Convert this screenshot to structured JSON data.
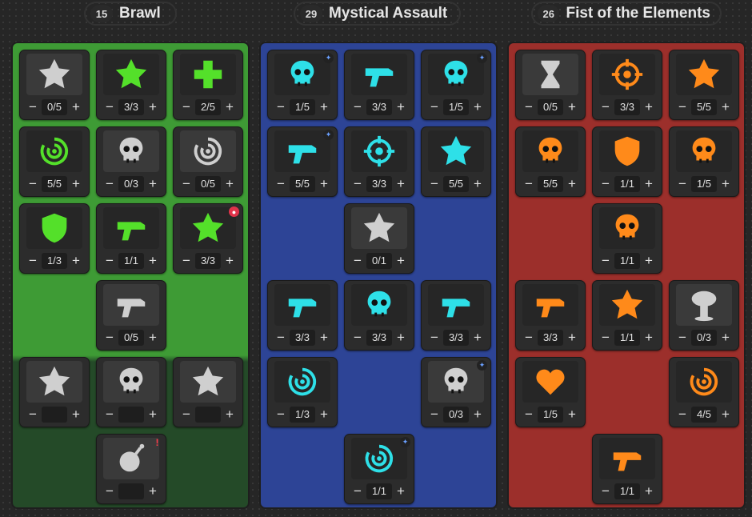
{
  "headers": [
    {
      "points": "15",
      "title": "Brawl",
      "color": "#27442a"
    },
    {
      "points": "29",
      "title": "Mystical Assault",
      "color": "#232b45"
    },
    {
      "points": "26",
      "title": "Fist of the Elements",
      "color": "#4a2424"
    }
  ],
  "trees": [
    {
      "bg": "#3e9b35",
      "bg_dark": "#244a28",
      "icon_color": "#54e02a",
      "skills": [
        {
          "value": "0/5",
          "active": false,
          "icon": "tree-stump-icon"
        },
        {
          "value": "3/3",
          "active": true,
          "icon": "cannon-blast-icon"
        },
        {
          "value": "2/5",
          "active": true,
          "icon": "heal-cross-icon"
        },
        {
          "value": "5/5",
          "active": true,
          "icon": "octopus-icon"
        },
        {
          "value": "0/3",
          "active": false,
          "icon": "skull-helmet-icon"
        },
        {
          "value": "0/5",
          "active": false,
          "icon": "swirl-icon"
        },
        {
          "value": "1/3",
          "active": true,
          "icon": "shield-icon"
        },
        {
          "value": "1/1",
          "active": true,
          "icon": "scythe-icon"
        },
        {
          "value": "3/3",
          "active": true,
          "icon": "beast-claw-icon",
          "badge": "skull"
        },
        {
          "value": "0/5",
          "active": false,
          "icon": "drill-icon"
        },
        {
          "value": "",
          "active": false,
          "icon": "fist-burst-icon"
        },
        {
          "value": "",
          "active": false,
          "icon": "skull-crossbones-icon"
        },
        {
          "value": "",
          "active": false,
          "icon": "winged-figure-icon"
        },
        {
          "value": "",
          "active": false,
          "icon": "bomb-icon",
          "badge": "alert"
        }
      ]
    },
    {
      "bg": "#2d4496",
      "icon_color": "#2ee0e8",
      "skills": [
        {
          "value": "1/5",
          "active": true,
          "icon": "triple-skull-icon",
          "badge": "feather"
        },
        {
          "value": "3/3",
          "active": true,
          "icon": "winged-pistol-icon"
        },
        {
          "value": "1/5",
          "active": true,
          "icon": "skull-banner-icon",
          "badge": "feather"
        },
        {
          "value": "5/5",
          "active": true,
          "icon": "magazine-arrow-icon",
          "badge": "feather"
        },
        {
          "value": "3/3",
          "active": true,
          "icon": "crosshair-icon"
        },
        {
          "value": "5/5",
          "active": true,
          "icon": "gauntlet-icon"
        },
        {
          "value": "0/1",
          "active": false,
          "icon": "rising-spirit-icon"
        },
        {
          "value": "3/3",
          "active": true,
          "icon": "spread-bullets-icon"
        },
        {
          "value": "3/3",
          "active": true,
          "icon": "dagger-skull-icon"
        },
        {
          "value": "3/3",
          "active": true,
          "icon": "crossed-guns-icon"
        },
        {
          "value": "1/3",
          "active": true,
          "icon": "vortex-icon"
        },
        {
          "value": "0/3",
          "active": false,
          "icon": "crowned-skull-icon",
          "badge": "feather"
        },
        {
          "value": "1/1",
          "active": true,
          "icon": "cycle-orb-icon",
          "badge": "feather"
        }
      ]
    },
    {
      "bg": "#9c2f2b",
      "icon_color": "#ff8a1a",
      "skills": [
        {
          "value": "0/5",
          "active": false,
          "icon": "hourglass-icon"
        },
        {
          "value": "3/3",
          "active": true,
          "icon": "target-fist-icon"
        },
        {
          "value": "5/5",
          "active": true,
          "icon": "blaze-glyph-icon"
        },
        {
          "value": "5/5",
          "active": true,
          "icon": "flaming-skull-icon"
        },
        {
          "value": "1/1",
          "active": true,
          "icon": "fist-shield-icon"
        },
        {
          "value": "1/5",
          "active": true,
          "icon": "skull-pair-icon"
        },
        {
          "value": "1/1",
          "active": true,
          "icon": "skull-fists-icon"
        },
        {
          "value": "3/3",
          "active": true,
          "icon": "bullet-spark-icon"
        },
        {
          "value": "1/1",
          "active": true,
          "icon": "fire-bar-icon"
        },
        {
          "value": "0/3",
          "active": false,
          "icon": "mushroom-cloud-icon"
        },
        {
          "value": "1/5",
          "active": true,
          "icon": "flaming-heart-icon"
        },
        {
          "value": "4/5",
          "active": true,
          "icon": "fire-serpent-icon"
        },
        {
          "value": "1/1",
          "active": true,
          "icon": "fire-pistol-icon"
        }
      ]
    }
  ]
}
